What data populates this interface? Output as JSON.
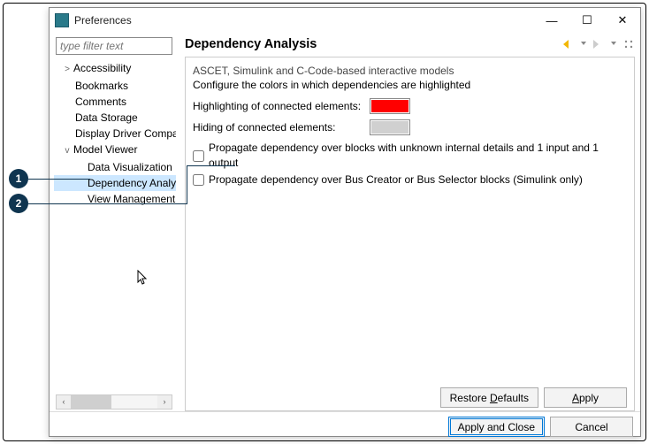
{
  "callouts": [
    "1",
    "2"
  ],
  "window": {
    "title": "Preferences",
    "minimize": "—",
    "maximize": "☐",
    "close": "✕"
  },
  "sidebar": {
    "filter_placeholder": "type filter text",
    "items": [
      {
        "label": "Accessibility",
        "level": 1,
        "arrow": ">"
      },
      {
        "label": "Bookmarks",
        "level": 1,
        "arrow": ""
      },
      {
        "label": "Comments",
        "level": 1,
        "arrow": ""
      },
      {
        "label": "Data Storage",
        "level": 1,
        "arrow": ""
      },
      {
        "label": "Display Driver Compatibility",
        "level": 1,
        "arrow": ""
      },
      {
        "label": "Model Viewer",
        "level": 1,
        "arrow": "v"
      },
      {
        "label": "Data Visualization",
        "level": 2,
        "arrow": ""
      },
      {
        "label": "Dependency Analysis",
        "level": 2,
        "arrow": "",
        "selected": true
      },
      {
        "label": "View Management",
        "level": 2,
        "arrow": ""
      }
    ]
  },
  "main": {
    "title": "Dependency Analysis",
    "desc1": "ASCET, Simulink and C-Code-based interactive models",
    "desc2": "Configure the colors in which dependencies are highlighted",
    "row_highlight_label": "Highlighting of connected elements:",
    "row_hide_label": "Hiding of connected elements:",
    "checkbox1": "Propagate dependency over blocks with unknown internal details and 1 input and 1 output",
    "checkbox2": "Propagate dependency over Bus Creator or Bus Selector blocks (Simulink only)",
    "restore_defaults_pre": "Restore ",
    "restore_defaults_u": "D",
    "restore_defaults_post": "efaults",
    "apply_u": "A",
    "apply_post": "pply"
  },
  "footer": {
    "apply_close": "Apply and Close",
    "cancel": "Cancel"
  },
  "colors": {
    "highlight_swatch": "#ff0000",
    "hide_swatch": "#d0d0d0"
  }
}
